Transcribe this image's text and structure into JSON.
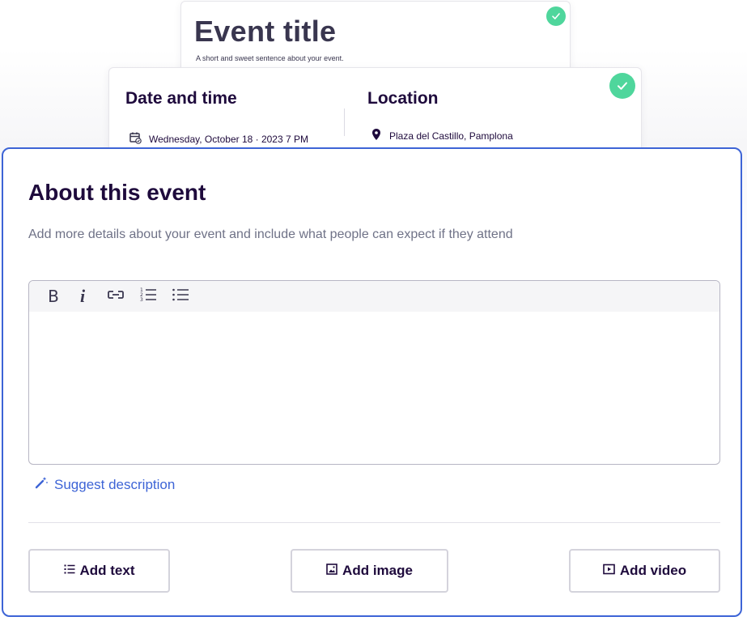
{
  "event_card": {
    "title": "Event title",
    "tagline": "A short and sweet sentence about your event."
  },
  "details_card": {
    "date_heading": "Date and time",
    "date_value": "Wednesday, October 18 · 2023 7 PM",
    "location_heading": "Location",
    "location_value": "Plaza del Castillo, Pamplona"
  },
  "about": {
    "title": "About this event",
    "description": "Add more details about your event and include what people can expect if they attend",
    "toolbar": {
      "bold_label": "B",
      "italic_label": "i"
    },
    "editor_value": "",
    "suggest_label": "Suggest description",
    "buttons": {
      "add_text": "Add text",
      "add_image": "Add image",
      "add_video": "Add video"
    }
  },
  "colors": {
    "accent_blue": "#3d64d6",
    "check_green": "#4fd69c",
    "text_dark": "#1e0a3c",
    "muted": "#6f7287"
  },
  "icons": [
    "check-icon",
    "calendar-icon",
    "location-pin-icon",
    "link-icon",
    "ordered-list-icon",
    "bullet-list-icon",
    "magic-wand-icon",
    "text-list-icon",
    "image-icon",
    "video-icon"
  ]
}
